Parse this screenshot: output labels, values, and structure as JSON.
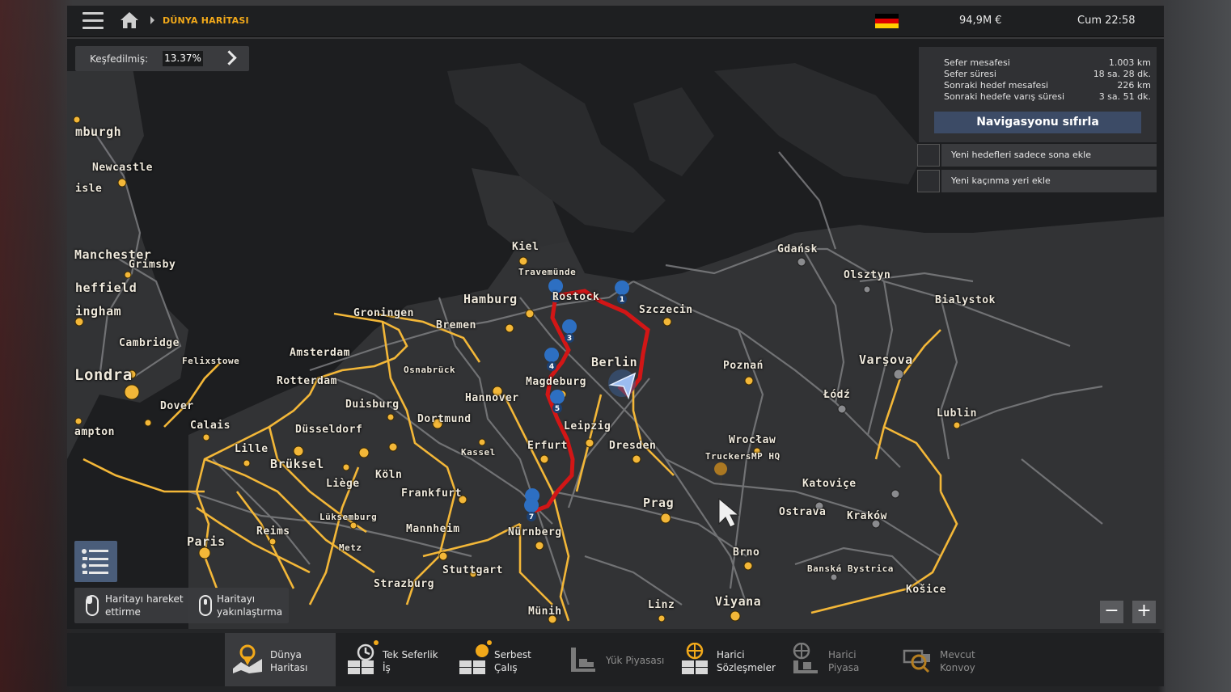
{
  "topbar": {
    "breadcrumb": "DÜNYA HARİTASI",
    "money": "94,9M €",
    "clock": "Cum 22:58",
    "flag_colors": [
      "#000000",
      "#dd0000",
      "#ffce00"
    ]
  },
  "explored": {
    "label": "Keşfedilmiş:",
    "value": "13.37%"
  },
  "navigation": {
    "rows": [
      {
        "label": "Sefer mesafesi",
        "value": "1.003 km"
      },
      {
        "label": "Sefer süresi",
        "value": "18 sa. 28 dk."
      },
      {
        "label": "Sonraki hedef mesafesi",
        "value": "226 km"
      },
      {
        "label": "Sonraki hedefe varış süresi",
        "value": "3 sa. 51 dk."
      }
    ],
    "reset_label": "Navigasyonu sıfırla",
    "options": [
      "Yeni hedefleri sadece sona ekle",
      "Yeni kaçınma yeri ekle"
    ]
  },
  "hints": {
    "move": [
      "Haritayı hareket",
      "ettirme"
    ],
    "zoom": [
      "Haritayı",
      "yakınlaştırma"
    ]
  },
  "zoom": {
    "minus": "−",
    "plus": "+"
  },
  "cities": [
    "mburgh",
    "Newcastle",
    "isle",
    "Manchester",
    "Grimsby",
    "heffield",
    "ingham",
    "Cambridge",
    "Felixstowe",
    "Londra",
    "Dover",
    "Calais",
    "ampton",
    "Lille",
    "Brüksel",
    "Paris",
    "Reims",
    "Metz",
    "Lüksemburg",
    "Liège",
    "Amsterdam",
    "Rotterdam",
    "Groningen",
    "Bremen",
    "Osnabrück",
    "Duisburg",
    "Düsseldorf",
    "Dortmund",
    "Köln",
    "Frankfurt",
    "Mannheim",
    "Strazburg",
    "Stuttgart",
    "Kassel",
    "Hannover",
    "Hamburg",
    "Kiel",
    "Travemünde",
    "Rostock",
    "Szczecin",
    "Berlin",
    "Magdeburg",
    "Leipzig",
    "Erfurt",
    "Dresden",
    "Nürnberg",
    "Münih",
    "Prag",
    "Linz",
    "Viyana",
    "Brno",
    "Poznań",
    "Wrocław",
    "TruckersMP HQ",
    "Katoviçe",
    "Ostrava",
    "Kraków",
    "Banská Bystrica",
    "Košice",
    "Gdańsk",
    "Olsztyn",
    "Bialystok",
    "Varşova",
    "Łódź",
    "Lublin"
  ],
  "route_markers": [
    "1",
    "2",
    "3",
    "4",
    "5",
    "6",
    "7"
  ],
  "bottom_tabs": [
    {
      "label": [
        "Dünya",
        "Haritası"
      ],
      "icon": "world-map-icon",
      "active": true,
      "enabled": true
    },
    {
      "label": [
        "Tek Seferlik",
        "İş"
      ],
      "icon": "quick-job-icon",
      "active": false,
      "enabled": true
    },
    {
      "label": [
        "Serbest",
        "Çalış"
      ],
      "icon": "freight-market-icon",
      "active": false,
      "enabled": true
    },
    {
      "label": [
        "Yük Piyasası"
      ],
      "icon": "cargo-market-icon",
      "active": false,
      "enabled": false
    },
    {
      "label": [
        "Harici",
        "Sözleşmeler"
      ],
      "icon": "external-contracts-icon",
      "active": false,
      "enabled": true
    },
    {
      "label": [
        "Harici",
        "Piyasa"
      ],
      "icon": "external-market-icon",
      "active": false,
      "enabled": false
    },
    {
      "label": [
        "Mevcut",
        "Konvoy"
      ],
      "icon": "convoy-icon",
      "active": false,
      "enabled": false
    }
  ]
}
